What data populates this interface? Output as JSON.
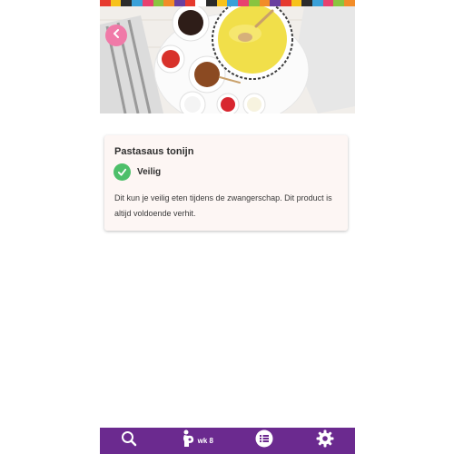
{
  "colors": {
    "accent_pink": "#f07aa8",
    "safe_green": "#4dbf6a",
    "nav_purple": "#6b2a8f",
    "stripe": [
      "#e63a2e",
      "#f7c21b",
      "#2b2b2b",
      "#3aa0d8",
      "#e8416f",
      "#8ac43f",
      "#f28c28",
      "#6a3fa0",
      "#e63a2e",
      "#ffffff",
      "#2b2b2b",
      "#f7c21b",
      "#3aa0d8",
      "#e8416f",
      "#8ac43f",
      "#f28c28",
      "#6a3fa0",
      "#e63a2e",
      "#f7c21b",
      "#2b2b2b",
      "#3aa0d8",
      "#e8416f",
      "#8ac43f",
      "#f28c28"
    ]
  },
  "header": {
    "back_icon": "chevron-left-icon"
  },
  "product": {
    "title": "Pastasaus tonijn",
    "status_icon": "check-circle-icon",
    "status": "Veilig",
    "description": "Dit kun je veilig eten tijdens de zwangerschap. Dit product is altijd voldoende verhit."
  },
  "nav": {
    "search_icon": "search-icon",
    "pregnancy_icon": "pregnant-belly-icon",
    "week_label": "wk 8",
    "list_icon": "list-icon",
    "settings_icon": "gear-icon"
  }
}
